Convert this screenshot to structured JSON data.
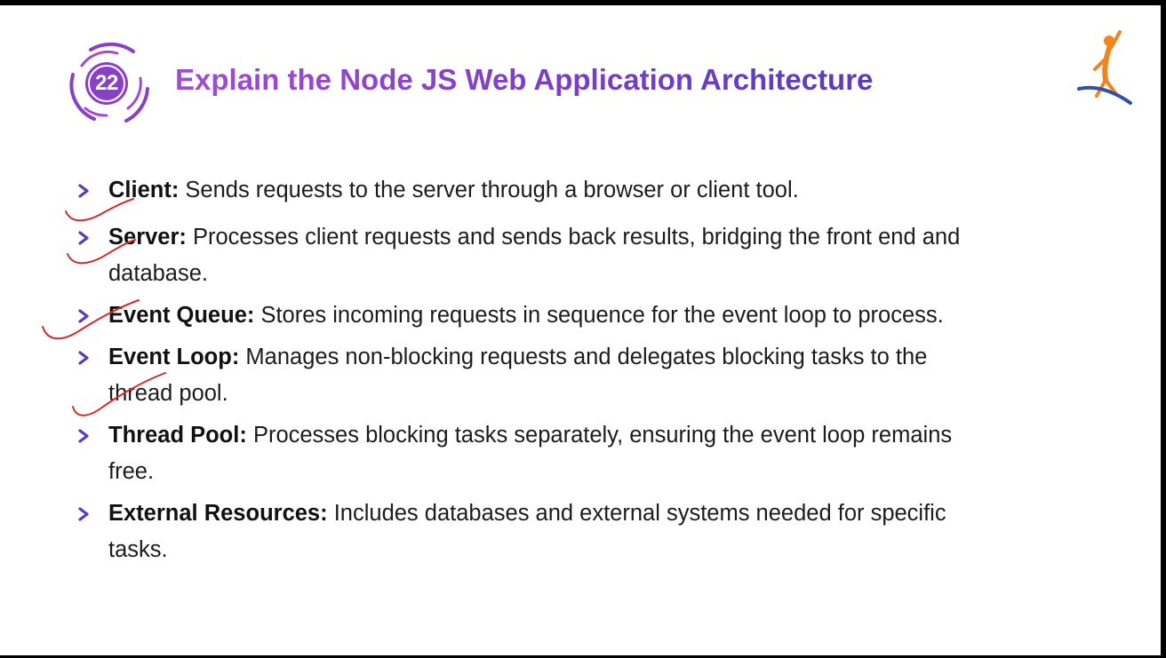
{
  "slide": {
    "number": "22",
    "title": "Explain the Node JS Web Application Architecture",
    "colors": {
      "title_start": "#a44bd6",
      "title_end": "#5b3bbd",
      "badge": "#8a3fc8",
      "chevron": "#5b3bbd",
      "ink": "#d62b2b",
      "logo_orange": "#f0851e",
      "logo_blue": "#2f4fae"
    },
    "icons": {
      "badge": "circle-number-badge",
      "bullet": "chevron-right-icon",
      "logo": "running-figure-logo"
    },
    "points": [
      {
        "term": "Client:",
        "description": "Sends requests to the server through a browser or client tool."
      },
      {
        "term": "Server:",
        "description": "Processes client requests and sends back results, bridging the front end and database."
      },
      {
        "term": "Event Queue:",
        "description": "Stores incoming requests in sequence for the event loop to process."
      },
      {
        "term": "Event Loop:",
        "description": "Manages non-blocking requests and delegates blocking tasks to the thread pool."
      },
      {
        "term": "Thread Pool:",
        "description": "Processes blocking tasks separately, ensuring the event loop remains free."
      },
      {
        "term": "External Resources:",
        "description": "Includes databases and external systems needed for specific tasks."
      }
    ]
  }
}
